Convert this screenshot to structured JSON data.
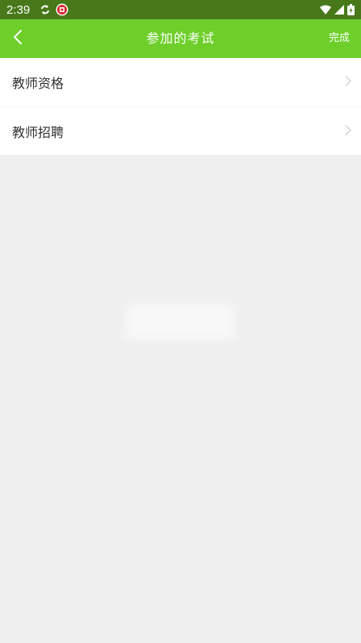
{
  "status_bar": {
    "time": "2:39",
    "left_icons": [
      "sync-icon",
      "app-badge-icon"
    ],
    "right_icons": [
      "wifi-icon",
      "signal-icon",
      "battery-icon"
    ]
  },
  "header": {
    "title": "参加的考试",
    "back_icon": "chevron-left-icon",
    "done_label": "完成"
  },
  "list": {
    "items": [
      {
        "label": "教师资格"
      },
      {
        "label": "教师招聘"
      }
    ]
  },
  "colors": {
    "status_bar": "#47791b",
    "app_bar": "#6ecf2b",
    "background": "#efefef",
    "item_text": "#333333"
  }
}
